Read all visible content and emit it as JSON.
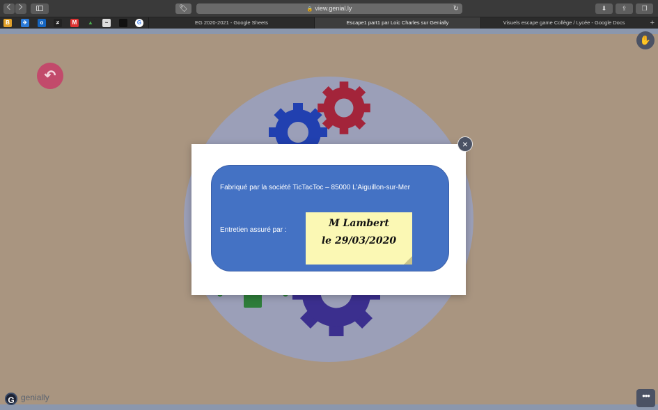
{
  "browser": {
    "url": "view.genial.ly",
    "tabs": [
      {
        "label": "EG 2020-2021 - Google Sheets",
        "active": false
      },
      {
        "label": "Escape1 part1 par Loic Charles sur Genially",
        "active": true
      },
      {
        "label": "Visuels escape game Collège / Lycée - Google Docs",
        "active": false
      }
    ],
    "favicons": [
      "bookmark-1-icon",
      "bookmark-2-icon",
      "outlook-icon",
      "bookmark-4-icon",
      "gmail-icon",
      "drive-icon",
      "bookmark-7-icon",
      "bookmark-8-icon",
      "google-icon"
    ]
  },
  "modal": {
    "line1": "Fabriqué par la société TicTacToc – 85000 L’Aiguillon-sur-Mer",
    "line2": "Entretien assuré par :",
    "note_line1": "M Lambert",
    "note_line2": "le 29/03/2020",
    "close_symbol": "×"
  },
  "page": {
    "back_symbol": "↶",
    "more_symbol": "•••",
    "logo_letter": "G",
    "logo_text": "genially"
  },
  "colors": {
    "background": "#a99580",
    "circle": "#9b9fb8",
    "card": "#4472c4",
    "note": "#fbf8b4",
    "back_button": "#c24a6b",
    "gear_blue": "#2140b0",
    "gear_red": "#a3243a",
    "gear_purple": "#3b2f8e"
  }
}
